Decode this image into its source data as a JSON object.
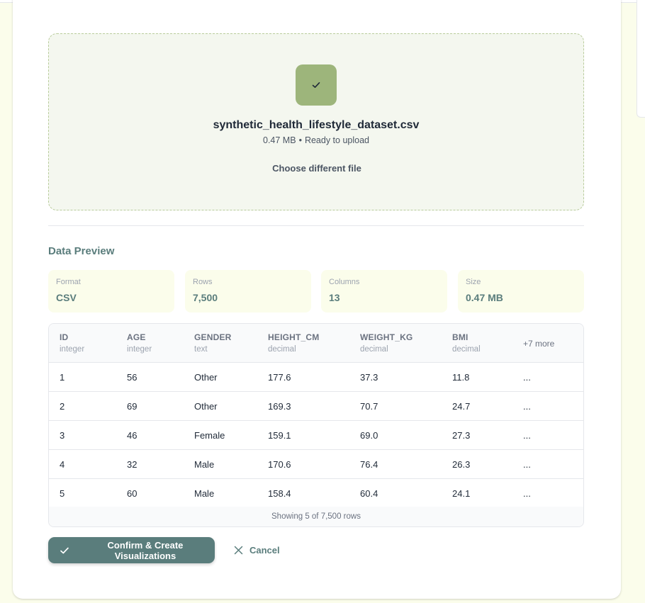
{
  "upload": {
    "file_name": "synthetic_health_lifestyle_dataset.csv",
    "file_size": "0.47 MB",
    "separator": "•",
    "file_status": "Ready to upload",
    "choose_different": "Choose different file"
  },
  "preview": {
    "title": "Data Preview",
    "stats": [
      {
        "label": "Format",
        "value": "CSV"
      },
      {
        "label": "Rows",
        "value": "7,500"
      },
      {
        "label": "Columns",
        "value": "13"
      },
      {
        "label": "Size",
        "value": "0.47 MB"
      }
    ]
  },
  "table": {
    "columns": [
      {
        "name": "ID",
        "type": "integer"
      },
      {
        "name": "AGE",
        "type": "integer"
      },
      {
        "name": "GENDER",
        "type": "text"
      },
      {
        "name": "HEIGHT_CM",
        "type": "decimal"
      },
      {
        "name": "WEIGHT_KG",
        "type": "decimal"
      },
      {
        "name": "BMI",
        "type": "decimal"
      }
    ],
    "more_columns": "+7 more",
    "rows": [
      [
        "1",
        "56",
        "Other",
        "177.6",
        "37.3",
        "11.8",
        "..."
      ],
      [
        "2",
        "69",
        "Other",
        "169.3",
        "70.7",
        "24.7",
        "..."
      ],
      [
        "3",
        "46",
        "Female",
        "159.1",
        "69.0",
        "27.3",
        "..."
      ],
      [
        "4",
        "32",
        "Male",
        "170.6",
        "76.4",
        "26.3",
        "..."
      ],
      [
        "5",
        "60",
        "Male",
        "158.4",
        "60.4",
        "24.1",
        "..."
      ]
    ],
    "footer": "Showing 5 of 7,500 rows"
  },
  "actions": {
    "confirm_label": "Confirm & Create Visualizations",
    "cancel_label": "Cancel"
  },
  "colors": {
    "accent": "#5a7d7c",
    "file_badge": "#9db57b",
    "page_background": "#fbfdeb",
    "dropzone_background": "#f4f7ef"
  },
  "icons": {
    "file_badge": "check-icon",
    "confirm": "check-icon",
    "cancel": "close-icon"
  }
}
